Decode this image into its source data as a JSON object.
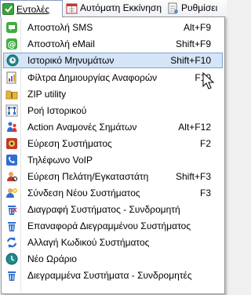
{
  "menubar": {
    "tabs": [
      {
        "label": "Εντολές",
        "icon": "commands-icon",
        "active": true
      },
      {
        "label": "Αυτόματη Εκκίνηση",
        "icon": "auto-start-icon",
        "active": false
      },
      {
        "label": "Ρυθμίσει",
        "icon": "settings-icon",
        "active": false
      }
    ]
  },
  "menu": {
    "items": [
      {
        "label": "Αποστολή SMS",
        "shortcut": "Alt+F9",
        "icon": "sms-icon",
        "highlighted": false
      },
      {
        "label": "Αποστολή eMail",
        "shortcut": "Shift+F9",
        "icon": "email-icon",
        "highlighted": false
      },
      {
        "label": "Ιστορικό Μηνυμάτων",
        "shortcut": "Shift+F10",
        "icon": "message-history-icon",
        "highlighted": true
      },
      {
        "label": "Φίλτρα Δημιουργίας Αναφορών",
        "shortcut": "F10",
        "icon": "report-filter-icon",
        "highlighted": false
      },
      {
        "label": "ZIP utility",
        "shortcut": "",
        "icon": "zip-folder-icon",
        "highlighted": false
      },
      {
        "label": "Ροή Ιστορικού",
        "shortcut": "",
        "icon": "history-flow-icon",
        "highlighted": false
      },
      {
        "label": "Action Αναμονές Σημάτων",
        "shortcut": "Alt+F12",
        "icon": "signal-queue-icon",
        "highlighted": false
      },
      {
        "label": "Εύρεση Συστήματος",
        "shortcut": "F2",
        "icon": "find-system-icon",
        "highlighted": false
      },
      {
        "label": "Τηλέφωνο VoIP",
        "shortcut": "",
        "icon": "voip-phone-icon",
        "highlighted": false
      },
      {
        "label": "Εύρεση Πελάτη/Εγκαταστάτη",
        "shortcut": "Shift+F3",
        "icon": "find-customer-icon",
        "highlighted": false
      },
      {
        "label": "Σύνδεση Νέου Συστήματος",
        "shortcut": "F3",
        "icon": "new-system-icon",
        "highlighted": false
      },
      {
        "label": "Διαγραφή Συστήματος - Συνδρομητή",
        "shortcut": "",
        "icon": "delete-system-icon",
        "highlighted": false
      },
      {
        "label": "Επαναφορά Διεγραμμένου Συστήματος",
        "shortcut": "",
        "icon": "restore-system-icon",
        "highlighted": false
      },
      {
        "label": "Αλλαγή Κωδικού Συστήματος",
        "shortcut": "",
        "icon": "change-code-icon",
        "highlighted": false
      },
      {
        "label": "Νέο Ωράριο",
        "shortcut": "",
        "icon": "new-schedule-icon",
        "highlighted": false
      },
      {
        "label": "Διεγραμμένα Συστήματα - Συνδρομητές",
        "shortcut": "",
        "icon": "deleted-systems-icon",
        "highlighted": false
      }
    ]
  },
  "colors": {
    "highlight_bg": "#d5e5f7",
    "highlight_border": "#7da2ce",
    "menu_border": "#979797"
  }
}
